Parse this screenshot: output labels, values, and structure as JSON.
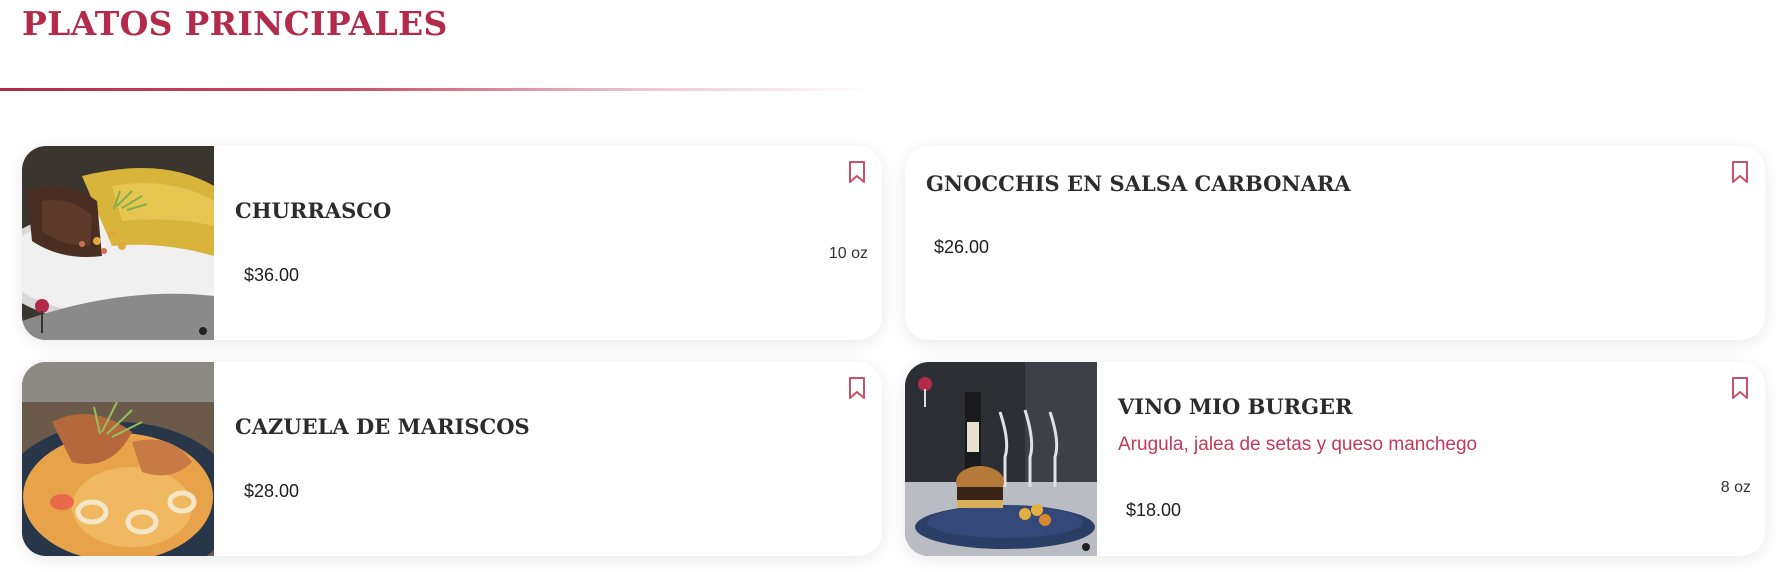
{
  "section": {
    "title": "PLATOS PRINCIPALES"
  },
  "colors": {
    "accent": "#b32a4a",
    "card_bg": "#ffffff",
    "text": "#2c2c2c"
  },
  "items": [
    {
      "name": "CHURRASCO",
      "price": "$36.00",
      "size": "10 oz",
      "has_image": true,
      "bookmark_icon": "bookmark-icon"
    },
    {
      "name": "GNOCCHIS EN SALSA CARBONARA",
      "price": "$26.00",
      "has_image": false,
      "bookmark_icon": "bookmark-icon"
    },
    {
      "name": "CAZUELA DE MARISCOS",
      "price": "$28.00",
      "has_image": true,
      "bookmark_icon": "bookmark-icon"
    },
    {
      "name": "VINO MIO BURGER",
      "description": "Arugula, jalea de setas y queso manchego",
      "price": "$18.00",
      "size": "8 oz",
      "has_image": true,
      "bookmark_icon": "bookmark-icon"
    }
  ]
}
